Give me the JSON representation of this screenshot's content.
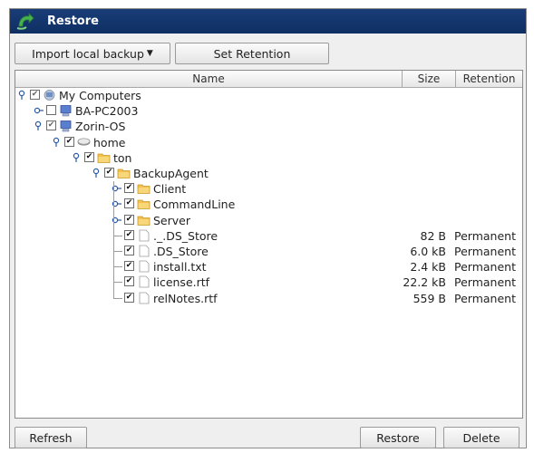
{
  "window": {
    "title": "Restore"
  },
  "toolbar": {
    "import_label": "Import local backup",
    "retention_label": "Set Retention"
  },
  "table": {
    "columns": {
      "name": "Name",
      "size": "Size",
      "retention": "Retention"
    }
  },
  "tree": [
    {
      "label": "My Computers",
      "checked": "partial",
      "icon": "computers-icon",
      "expanded": true
    },
    {
      "label": "BA-PC2003",
      "checked": "none",
      "icon": "computer-icon",
      "expanded": false
    },
    {
      "label": "Zorin-OS",
      "checked": "partial",
      "icon": "computer-icon",
      "expanded": true
    },
    {
      "label": "home",
      "checked": "full",
      "icon": "drive-icon",
      "expanded": true
    },
    {
      "label": "ton",
      "checked": "full",
      "icon": "folder-icon",
      "expanded": true
    },
    {
      "label": "BackupAgent",
      "checked": "full",
      "icon": "folder-icon",
      "expanded": true
    },
    {
      "label": "Client",
      "checked": "full",
      "icon": "folder-icon",
      "expanded": false
    },
    {
      "label": "CommandLine",
      "checked": "full",
      "icon": "folder-icon",
      "expanded": false
    },
    {
      "label": "Server",
      "checked": "full",
      "icon": "folder-icon",
      "expanded": false
    },
    {
      "label": "._.DS_Store",
      "checked": "full",
      "icon": "file-icon",
      "size": "82 B",
      "retention": "Permanent"
    },
    {
      "label": ".DS_Store",
      "checked": "full",
      "icon": "file-icon",
      "size": "6.0 kB",
      "retention": "Permanent"
    },
    {
      "label": "install.txt",
      "checked": "full",
      "icon": "file-icon",
      "size": "2.4 kB",
      "retention": "Permanent"
    },
    {
      "label": "license.rtf",
      "checked": "full",
      "icon": "file-icon",
      "size": "22.2 kB",
      "retention": "Permanent"
    },
    {
      "label": "relNotes.rtf",
      "checked": "full",
      "icon": "file-icon",
      "size": "559 B",
      "retention": "Permanent"
    }
  ],
  "footer": {
    "refresh_label": "Refresh",
    "restore_label": "Restore",
    "delete_label": "Delete"
  },
  "colors": {
    "titlebar": "#0e2f63",
    "folder": "#f2c14e",
    "app_icon": "#3aa84a"
  }
}
